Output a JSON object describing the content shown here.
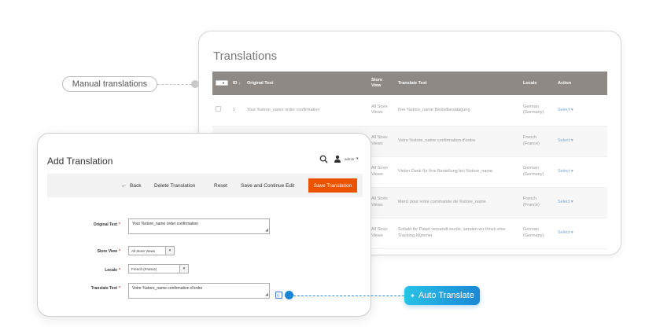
{
  "grid": {
    "title": "Translations",
    "columns": [
      "ID",
      "Original Text",
      "Store View",
      "Translate Text",
      "Locale",
      "Action"
    ],
    "sort_arrow": "↓",
    "mass_select_caret": "▾",
    "rows": [
      {
        "id": "1",
        "original": "Your %store_name order confirmation",
        "store": "All Store Views",
        "translate": "Ihre %store_name Bestellbestätigung",
        "locale": "German (Germany)",
        "action": "Select ▾"
      },
      {
        "id": "",
        "original": "",
        "store": "All Store Views",
        "translate": "Votre %store_name confirmation d'ordre",
        "locale": "French (France)",
        "action": "Select ▾"
      },
      {
        "id": "",
        "original": "",
        "store": "All Store Views",
        "translate": "Vielen Dank für Ihre Bestellung bei %store_name.",
        "locale": "German (Germany)",
        "action": "Select ▾"
      },
      {
        "id": "",
        "original": "",
        "store": "All Store Views",
        "translate": "Merci pour votre commande de %store_name.",
        "locale": "French (France)",
        "action": "Select ▾"
      },
      {
        "id": "",
        "original": "",
        "store": "All Store Views",
        "translate": "Sobald Ihr Paket versandt wurde, senden wir Ihnen eine Tracking-Nummer.",
        "locale": "German (Germany)",
        "action": "Select ▾"
      }
    ]
  },
  "callouts": {
    "manual": "Manual translations",
    "auto": "Auto Translate",
    "auto_icon": "✦"
  },
  "form": {
    "title": "Add Translation",
    "user_name": "admin",
    "user_caret": "▾",
    "toolbar": {
      "back_arrow": "←",
      "back": "Back",
      "delete": "Delete Translation",
      "reset": "Reset",
      "save_continue": "Save and Continue Edit",
      "save": "Save Translation"
    },
    "fields": {
      "original_label": "Original Text",
      "original_value": "Your %store_name order confirmation",
      "store_label": "Store View",
      "store_value": "All Store Views",
      "locale_label": "Locale",
      "locale_value": "French (France)",
      "translate_label": "Translate Text",
      "translate_value": "Votre %store_name confirmation d'ordre",
      "required_mark": "*",
      "select_arrow": "▾",
      "resize_grip": "◢"
    }
  },
  "colors": {
    "header_bg": "#8e8985",
    "primary_button": "#eb5202",
    "auto_accent": "#1b88d6",
    "link": "#79a6d1"
  }
}
